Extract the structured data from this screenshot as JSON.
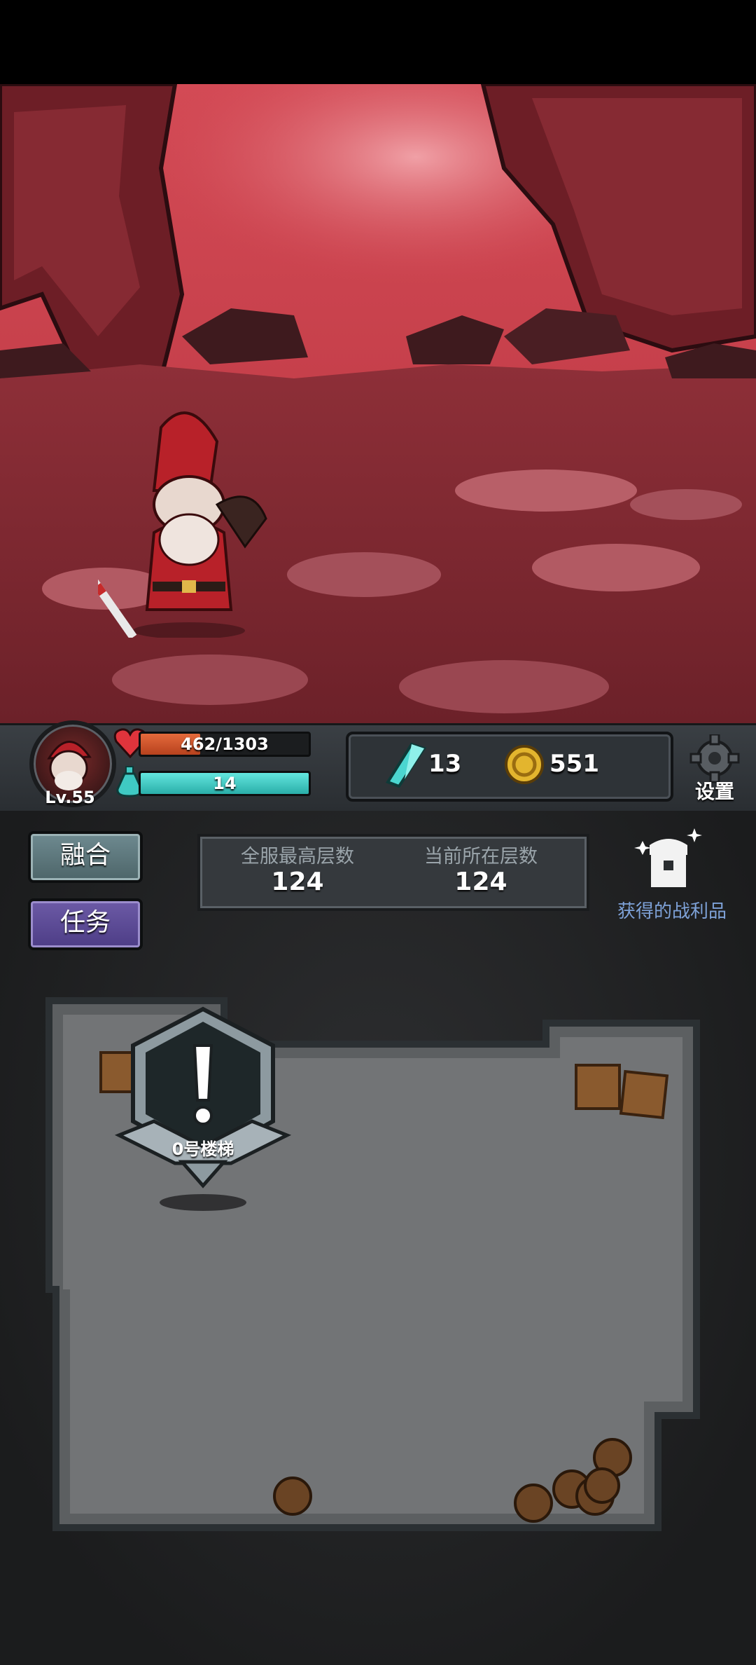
{
  "player": {
    "level": "Lv.55",
    "hp": {
      "text": "462/1303",
      "current": 462,
      "max": 1303
    },
    "mp": {
      "text": "14",
      "fill_fraction": 1.0
    }
  },
  "resources": {
    "crystal": {
      "icon": "crystal-icon",
      "count": "13"
    },
    "coin": {
      "icon": "coin-icon",
      "count": "551"
    }
  },
  "settings": {
    "icon": "gear-icon",
    "label": "设置"
  },
  "buttons": {
    "fusion": "融合",
    "task": "任务"
  },
  "floors": {
    "max_label": "全服最高层数",
    "max_value": "124",
    "current_label": "当前所在层数",
    "current_value": "124"
  },
  "loot": {
    "icon": "treasure-chest-icon",
    "label": "获得的战利品"
  },
  "map": {
    "stair_label": "0号楼梯",
    "stair_icon": "exclamation-icon"
  },
  "colors": {
    "hp": "#d45a2c",
    "mp": "#3fc9c3",
    "task_button": "#5a4796",
    "fusion_button": "#5b7579",
    "loot_label": "#7ea2d8",
    "scene_bg": "#c8414c"
  }
}
